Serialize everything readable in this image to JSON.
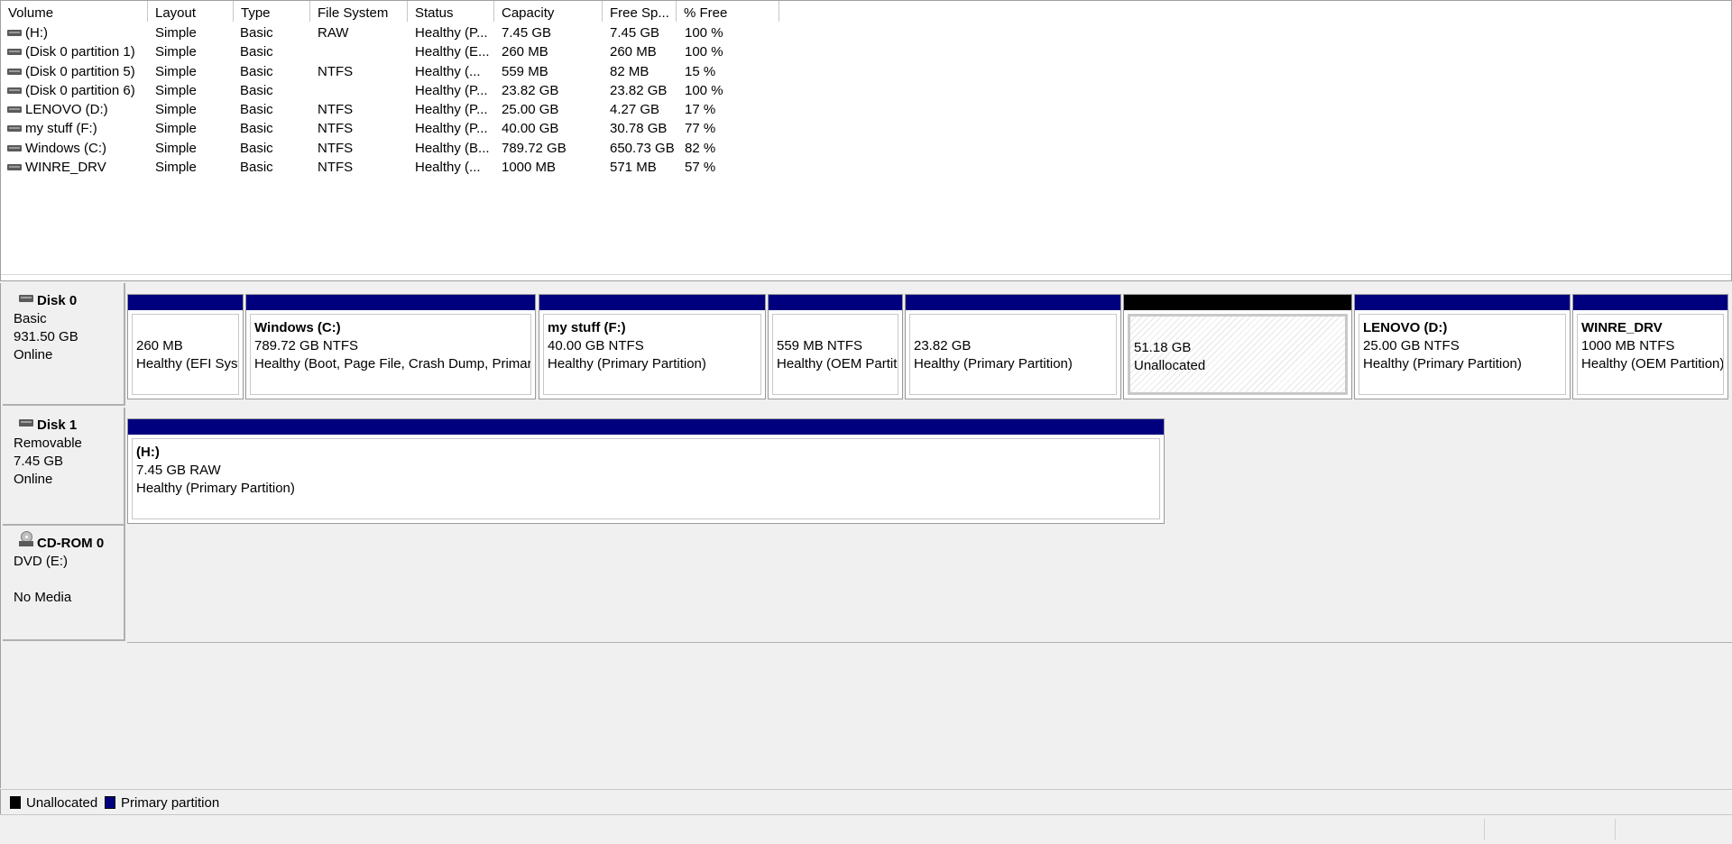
{
  "colors": {
    "primary_partition": "#00007f",
    "unallocated": "#000000",
    "window_bg": "#f0f0f0"
  },
  "columns": [
    {
      "key": "volume",
      "label": "Volume"
    },
    {
      "key": "layout",
      "label": "Layout"
    },
    {
      "key": "type",
      "label": "Type"
    },
    {
      "key": "fs",
      "label": "File System"
    },
    {
      "key": "status",
      "label": "Status"
    },
    {
      "key": "capacity",
      "label": "Capacity"
    },
    {
      "key": "free",
      "label": "Free Sp..."
    },
    {
      "key": "pct",
      "label": "% Free"
    }
  ],
  "volumes": [
    {
      "volume": "(H:)",
      "layout": "Simple",
      "type": "Basic",
      "fs": "RAW",
      "status": "Healthy (P...",
      "capacity": "7.45 GB",
      "free": "7.45 GB",
      "pct": "100 %"
    },
    {
      "volume": "(Disk 0 partition 1)",
      "layout": "Simple",
      "type": "Basic",
      "fs": "",
      "status": "Healthy (E...",
      "capacity": "260 MB",
      "free": "260 MB",
      "pct": "100 %"
    },
    {
      "volume": "(Disk 0 partition 5)",
      "layout": "Simple",
      "type": "Basic",
      "fs": "NTFS",
      "status": "Healthy (...",
      "capacity": "559 MB",
      "free": "82 MB",
      "pct": "15 %"
    },
    {
      "volume": "(Disk 0 partition 6)",
      "layout": "Simple",
      "type": "Basic",
      "fs": "",
      "status": "Healthy (P...",
      "capacity": "23.82 GB",
      "free": "23.82 GB",
      "pct": "100 %"
    },
    {
      "volume": "LENOVO (D:)",
      "layout": "Simple",
      "type": "Basic",
      "fs": "NTFS",
      "status": "Healthy (P...",
      "capacity": "25.00 GB",
      "free": "4.27 GB",
      "pct": "17 %"
    },
    {
      "volume": "my stuff (F:)",
      "layout": "Simple",
      "type": "Basic",
      "fs": "NTFS",
      "status": "Healthy (P...",
      "capacity": "40.00 GB",
      "free": "30.78 GB",
      "pct": "77 %"
    },
    {
      "volume": "Windows (C:)",
      "layout": "Simple",
      "type": "Basic",
      "fs": "NTFS",
      "status": "Healthy (B...",
      "capacity": "789.72 GB",
      "free": "650.73 GB",
      "pct": "82 %"
    },
    {
      "volume": "WINRE_DRV",
      "layout": "Simple",
      "type": "Basic",
      "fs": "NTFS",
      "status": "Healthy (...",
      "capacity": "1000 MB",
      "free": "571 MB",
      "pct": "57 %"
    }
  ],
  "disks": [
    {
      "name": "Disk 0",
      "kind": "Basic",
      "size": "931.50 GB",
      "state": "Online",
      "partitions": [
        {
          "name": "",
          "size": "260 MB",
          "status": "Healthy (EFI System Partition)",
          "kind": "primary"
        },
        {
          "name": "Windows  (C:)",
          "size": "789.72 GB NTFS",
          "status": "Healthy (Boot, Page File, Crash Dump, Primary Partition)",
          "kind": "primary"
        },
        {
          "name": "my stuff  (F:)",
          "size": "40.00 GB NTFS",
          "status": "Healthy (Primary Partition)",
          "kind": "primary"
        },
        {
          "name": "",
          "size": "559 MB NTFS",
          "status": "Healthy (OEM Partition)",
          "kind": "primary"
        },
        {
          "name": "",
          "size": "23.82 GB",
          "status": "Healthy (Primary Partition)",
          "kind": "primary"
        },
        {
          "name": "",
          "size": "51.18 GB",
          "status": "Unallocated",
          "kind": "unallocated"
        },
        {
          "name": "LENOVO  (D:)",
          "size": "25.00 GB NTFS",
          "status": "Healthy (Primary Partition)",
          "kind": "primary"
        },
        {
          "name": "WINRE_DRV",
          "size": "1000 MB NTFS",
          "status": "Healthy (OEM Partition)",
          "kind": "primary"
        }
      ]
    },
    {
      "name": "Disk 1",
      "kind": "Removable",
      "size": "7.45 GB",
      "state": "Online",
      "partitions": [
        {
          "name": "(H:)",
          "size": "7.45 GB RAW",
          "status": "Healthy (Primary Partition)",
          "kind": "primary"
        }
      ]
    },
    {
      "name": "CD-ROM 0",
      "kind": "DVD (E:)",
      "size": "",
      "state": "No Media",
      "partitions": []
    }
  ],
  "legend": [
    {
      "label": "Unallocated",
      "color": "#000000"
    },
    {
      "label": "Primary partition",
      "color": "#00007f"
    }
  ]
}
